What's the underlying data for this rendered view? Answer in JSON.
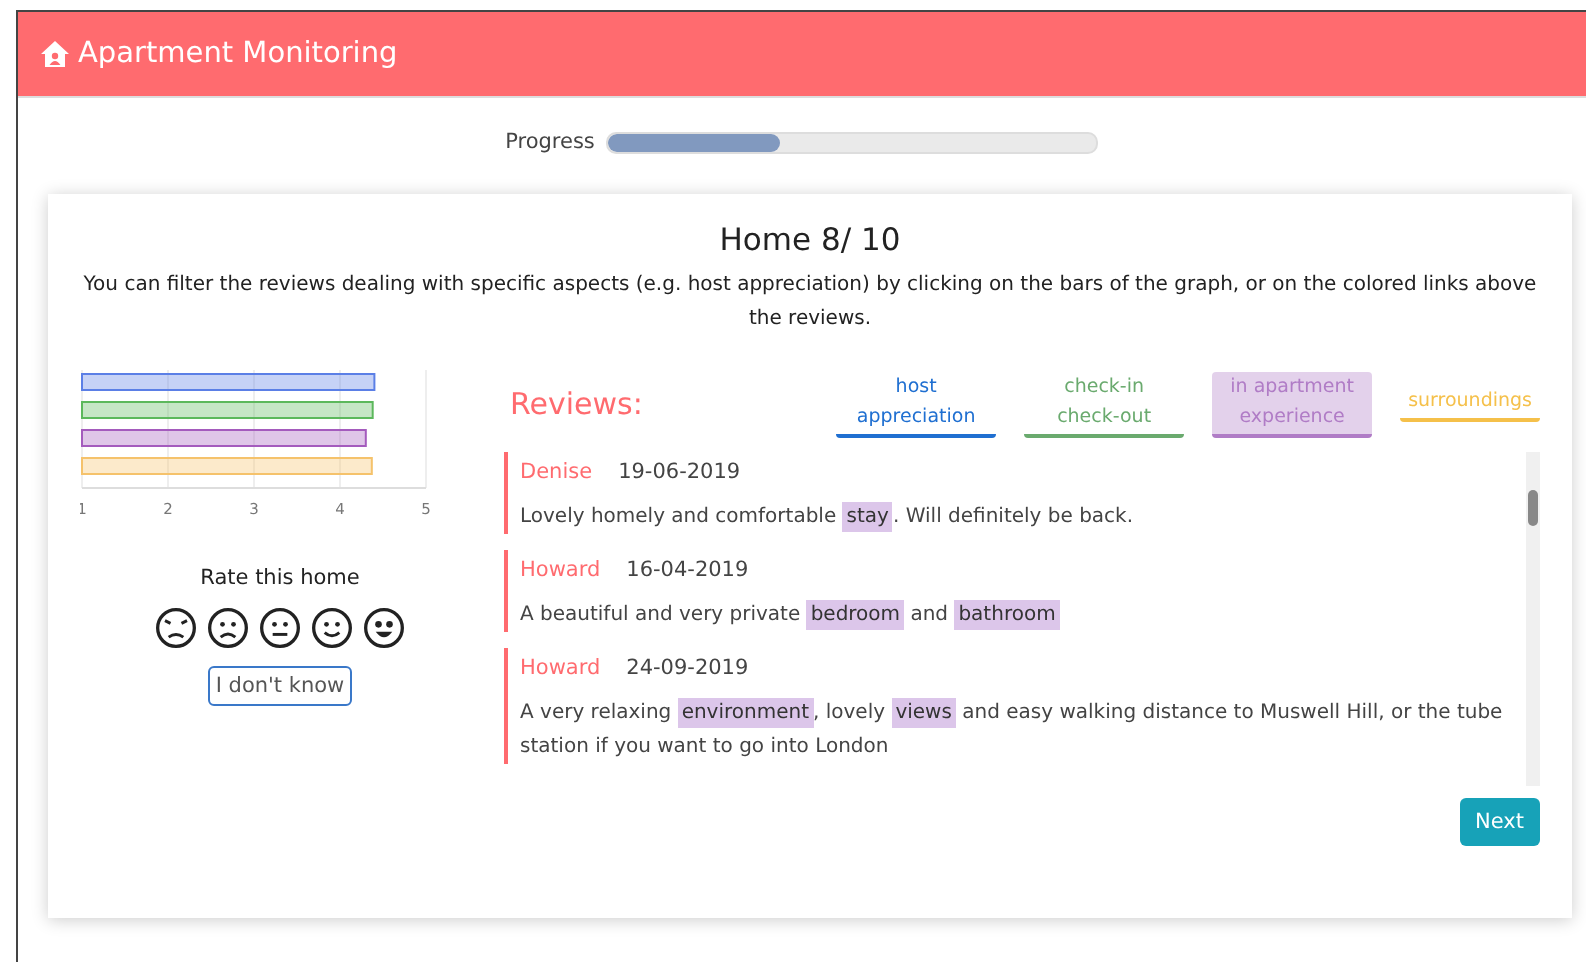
{
  "header": {
    "title": "Apartment Monitoring"
  },
  "progress": {
    "label": "Progress",
    "level": 0.35
  },
  "card": {
    "title": "Home 8/ 10",
    "instructions": "You can filter the reviews dealing with specific aspects (e.g. host appreciation) by clicking on the bars of the graph, or on the colored links above the reviews."
  },
  "chart_data": {
    "type": "bar",
    "orientation": "horizontal",
    "xlim": [
      1,
      5
    ],
    "grid": true,
    "xticks": [
      1,
      2,
      3,
      4,
      5
    ],
    "series": [
      {
        "color": "#5b7fe6",
        "values": [
          4.4,
          null,
          null,
          null
        ]
      },
      {
        "color": "#5cb85c",
        "values": [
          null,
          4.38,
          null,
          null
        ]
      },
      {
        "color": "#a45bbd",
        "values": [
          null,
          null,
          4.3,
          null
        ]
      },
      {
        "color": "#f5c26b",
        "values": [
          null,
          null,
          null,
          4.37
        ]
      }
    ]
  },
  "rating": {
    "label": "Rate this home",
    "faces": [
      {
        "kind": "angry"
      },
      {
        "kind": "sad"
      },
      {
        "kind": "neutral"
      },
      {
        "kind": "smile"
      },
      {
        "kind": "happy"
      }
    ],
    "unknown_button": "I don't know"
  },
  "reviews_title": "Reviews:",
  "filters": [
    {
      "label": "host appreciation",
      "color": "#1f6fd1",
      "selected": false
    },
    {
      "label": "check-in check-out",
      "color": "#6aaa6e",
      "selected": false
    },
    {
      "label": "in apartment experience",
      "color": "#b07cc6",
      "selected": true
    },
    {
      "label": "surroundings",
      "color": "#f5c04a",
      "selected": false
    }
  ],
  "reviews": [
    {
      "author": "Denise",
      "date": "19-06-2019",
      "segments": [
        {
          "text": "Lovely homely and comfortable ",
          "highlighted": false
        },
        {
          "text": "stay",
          "highlighted": true
        },
        {
          "text": ". Will definitely be back.",
          "highlighted": false
        }
      ]
    },
    {
      "author": "Howard",
      "date": "16-04-2019",
      "segments": [
        {
          "text": "A beautiful and very private ",
          "highlighted": false
        },
        {
          "text": "bedroom",
          "highlighted": true
        },
        {
          "text": " and ",
          "highlighted": false
        },
        {
          "text": "bathroom",
          "highlighted": true
        }
      ]
    },
    {
      "author": "Howard",
      "date": "24-09-2019",
      "segments": [
        {
          "text": "A very relaxing ",
          "highlighted": false
        },
        {
          "text": "environment",
          "highlighted": true
        },
        {
          "text": ", lovely ",
          "highlighted": false
        },
        {
          "text": "views",
          "highlighted": true
        },
        {
          "text": " and easy walking distance to Muswell Hill, or the tube station if you want to go into London",
          "highlighted": false
        }
      ]
    }
  ],
  "next_button": "Next"
}
